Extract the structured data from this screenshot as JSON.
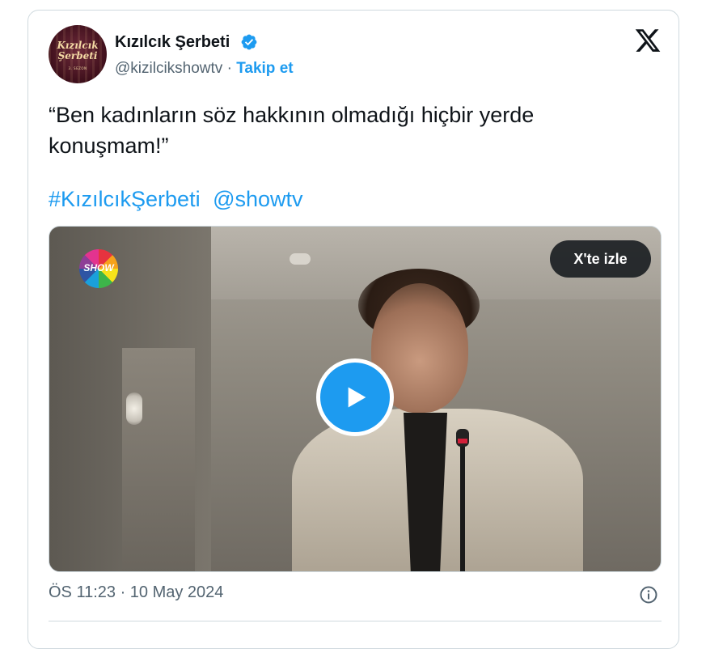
{
  "account": {
    "name": "Kızılcık Şerbeti",
    "handle": "@kizilcikshowtv",
    "separator": "·",
    "follow_label": "Takip et",
    "avatar_logo_line1": "Kızılcık",
    "avatar_logo_line2": "Şerbeti",
    "avatar_season": "3. SEZON",
    "verified": true
  },
  "tweet": {
    "text": "“Ben kadınların söz hakkının olmadığı hiçbir yerde konuşmam!”",
    "hashtag": "#KızılcıkŞerbeti",
    "mention": "@showtv"
  },
  "media": {
    "channel_logo_text": "SHOW",
    "watch_label": "X'te izle",
    "play_icon": "play-icon"
  },
  "meta": {
    "timestamp": "ÖS 11:23 · 10 May 2024",
    "info_icon": "info-icon"
  },
  "colors": {
    "accent": "#1d9bf0",
    "text": "#0f1419",
    "secondary_text": "#536471",
    "border": "#cfd9de"
  }
}
